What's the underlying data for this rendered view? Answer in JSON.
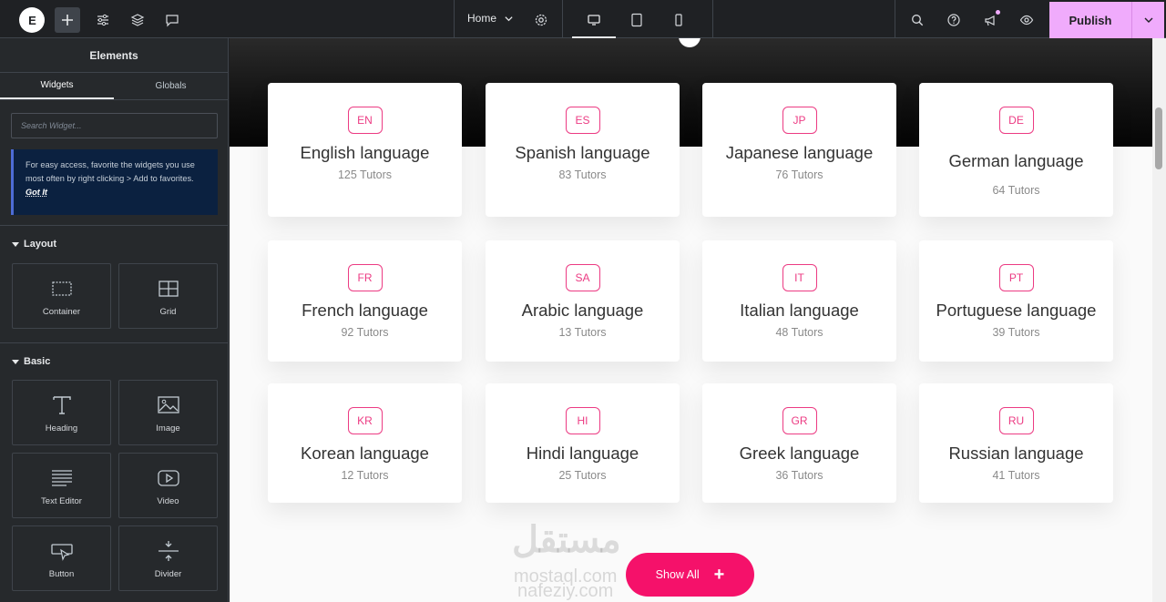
{
  "topbar": {
    "logo_text": "E",
    "page_name": "Home",
    "publish_label": "Publish"
  },
  "panel": {
    "title": "Elements",
    "tabs": [
      "Widgets",
      "Globals"
    ],
    "search_placeholder": "Search Widget...",
    "tip_text": "For easy access, favorite the widgets you use most often by right clicking > Add to favorites.",
    "tip_link": "Got It",
    "categories": [
      {
        "label": "Layout",
        "widgets": [
          "Container",
          "Grid"
        ]
      },
      {
        "label": "Basic",
        "widgets": [
          "Heading",
          "Image",
          "Text Editor",
          "Video",
          "Button",
          "Divider"
        ]
      }
    ]
  },
  "cards": [
    {
      "code": "EN",
      "name": "English language",
      "count": "125 Tutors"
    },
    {
      "code": "ES",
      "name": "Spanish language",
      "count": "83 Tutors"
    },
    {
      "code": "JP",
      "name": "Japanese language",
      "count": "76 Tutors"
    },
    {
      "code": "DE",
      "name": "German language",
      "count": "64 Tutors"
    },
    {
      "code": "FR",
      "name": "French language",
      "count": "92 Tutors"
    },
    {
      "code": "SA",
      "name": "Arabic language",
      "count": "13 Tutors"
    },
    {
      "code": "IT",
      "name": "Italian language",
      "count": "48 Tutors"
    },
    {
      "code": "PT",
      "name": "Portuguese language",
      "count": "39 Tutors"
    },
    {
      "code": "KR",
      "name": "Korean language",
      "count": "12 Tutors"
    },
    {
      "code": "HI",
      "name": "Hindi language",
      "count": "25 Tutors"
    },
    {
      "code": "GR",
      "name": "Greek language",
      "count": "36 Tutors"
    },
    {
      "code": "RU",
      "name": "Russian language",
      "count": "41 Tutors"
    }
  ],
  "show_all_label": "Show All",
  "watermark": {
    "arabic": "مستقل",
    "line1": "mostaql.com",
    "line2": "nafeziy.com"
  },
  "colors": {
    "accent": "#f0abfc",
    "brand_pink": "#ec3b83",
    "button": "#f5116a"
  }
}
